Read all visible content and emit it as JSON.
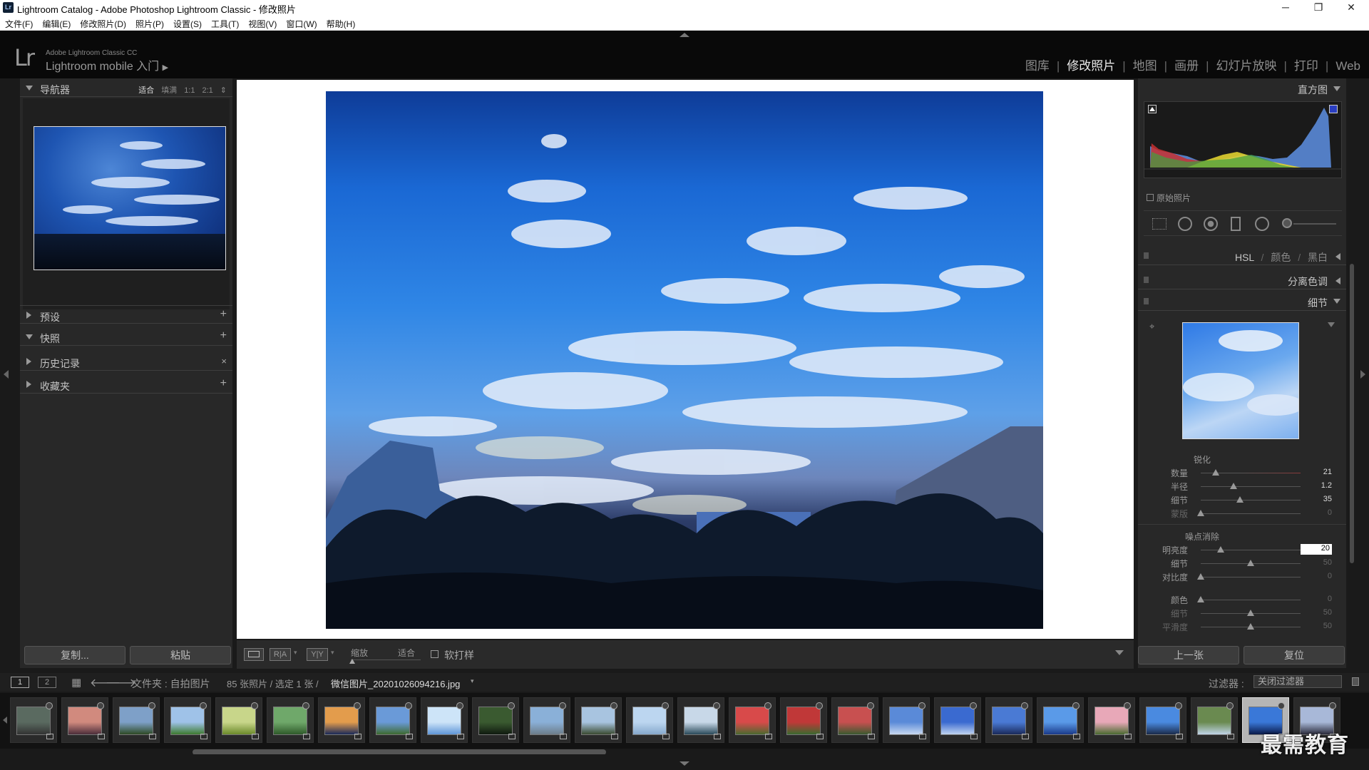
{
  "window": {
    "title": "Lightroom Catalog - Adobe Photoshop Lightroom Classic - 修改照片",
    "app_icon": "Lr"
  },
  "menu": [
    "文件(F)",
    "编辑(E)",
    "修改照片(D)",
    "照片(P)",
    "设置(S)",
    "工具(T)",
    "视图(V)",
    "窗口(W)",
    "帮助(H)"
  ],
  "identity": {
    "logo": "Lr",
    "line1": "Adobe Lightroom Classic CC",
    "line2": "Lightroom mobile 入门",
    "arrow": "▶"
  },
  "modules": [
    "图库",
    "修改照片",
    "地图",
    "画册",
    "幻灯片放映",
    "打印",
    "Web"
  ],
  "active_module": "修改照片",
  "left": {
    "navigator": {
      "label": "导航器",
      "zoom": [
        "适合",
        "填满",
        "1:1",
        "2:1"
      ],
      "zoom_active": "适合"
    },
    "panels": [
      {
        "label": "预设",
        "action": "+"
      },
      {
        "label": "快照",
        "action": "+"
      },
      {
        "label": "历史记录",
        "action": "×"
      },
      {
        "label": "收藏夹",
        "action": "+"
      }
    ],
    "copy": "复制...",
    "paste": "粘贴"
  },
  "toolbar": {
    "ra": "R|A",
    "yy": "Y|Y",
    "zoom_label": "缩放",
    "zoom_value": "适合",
    "softproof": "软打样"
  },
  "right": {
    "histogram_label": "直方图",
    "original_photo": "原始照片",
    "hsl": "HSL",
    "color": "颜色",
    "bw": "黑白",
    "sep": "/",
    "split_toning": "分离色调",
    "detail": "细节",
    "sharpen": {
      "title": "锐化",
      "rows": [
        {
          "label": "数量",
          "value": "21",
          "pos": 0.15
        },
        {
          "label": "半径",
          "value": "1.2",
          "pos": 0.33
        },
        {
          "label": "细节",
          "value": "35",
          "pos": 0.39
        },
        {
          "label": "蒙版",
          "value": "0",
          "pos": 0.0
        }
      ]
    },
    "noise": {
      "title": "噪点消除",
      "rows": [
        {
          "label": "明亮度",
          "value": "20",
          "pos": 0.2
        },
        {
          "label": "细节",
          "value": "50",
          "pos": 0.5
        },
        {
          "label": "对比度",
          "value": "0",
          "pos": 0.0
        },
        {
          "label": "颜色",
          "value": "0",
          "pos": 0.0
        },
        {
          "label": "细节",
          "value": "50",
          "pos": 0.5
        },
        {
          "label": "平滑度",
          "value": "50",
          "pos": 0.5
        }
      ]
    },
    "prev": "上一张",
    "reset": "复位"
  },
  "filmbar": {
    "view1": "1",
    "view2": "2",
    "source": "文件夹 : 自拍图片",
    "count": "85 张照片 / 选定 1 张 /",
    "filename": "微信图片_20201026094216.jpg",
    "filter_label": "过滤器 :",
    "filter_value": "关闭过滤器"
  },
  "thumbs": [
    {
      "c1": "#5a6a60",
      "c2": "#333"
    },
    {
      "c1": "#d18a7e",
      "c2": "#4b2d3a"
    },
    {
      "c1": "#7ea0c8",
      "c2": "#2e4a24"
    },
    {
      "c1": "#9fc2e8",
      "c2": "#3d7a2f"
    },
    {
      "c1": "#c8d68a",
      "c2": "#6b8a2a"
    },
    {
      "c1": "#6fa86a",
      "c2": "#2f5a2a"
    },
    {
      "c1": "#e39c4c",
      "c2": "#1a2a5a"
    },
    {
      "c1": "#6a9ad8",
      "c2": "#3e6a30"
    },
    {
      "c1": "#cde4f8",
      "c2": "#5f96d8"
    },
    {
      "c1": "#3a5a30",
      "c2": "#101a10"
    },
    {
      "c1": "#8ab0d8",
      "c2": "#6d7d8a"
    },
    {
      "c1": "#a8c4e0",
      "c2": "#3a4a30"
    },
    {
      "c1": "#bcd6f0",
      "c2": "#86a8cc"
    },
    {
      "c1": "#c8d8e8",
      "c2": "#2a4a5a"
    },
    {
      "c1": "#d84a4a",
      "c2": "#4a6a30"
    },
    {
      "c1": "#c03838",
      "c2": "#3a6a30"
    },
    {
      "c1": "#c85050",
      "c2": "#3a5a30"
    },
    {
      "c1": "#5a8ad8",
      "c2": "#c8d8f0"
    },
    {
      "c1": "#3a6ad0",
      "c2": "#c0d4f0"
    },
    {
      "c1": "#4a7ad4",
      "c2": "#1a2a5a"
    },
    {
      "c1": "#5a9ae8",
      "c2": "#1a3a8a"
    },
    {
      "c1": "#e8a8b8",
      "c2": "#4a6a30"
    },
    {
      "c1": "#4a8ae0",
      "c2": "#1a2a4a"
    },
    {
      "c1": "#6a8a50",
      "c2": "#c0d4e8"
    },
    {
      "c1": "#3a78d8",
      "c2": "#0a1a4a"
    },
    {
      "c1": "#a8b8d8",
      "c2": "#2a2a3a"
    }
  ],
  "selected_thumb": 24,
  "watermark": "最需教育"
}
